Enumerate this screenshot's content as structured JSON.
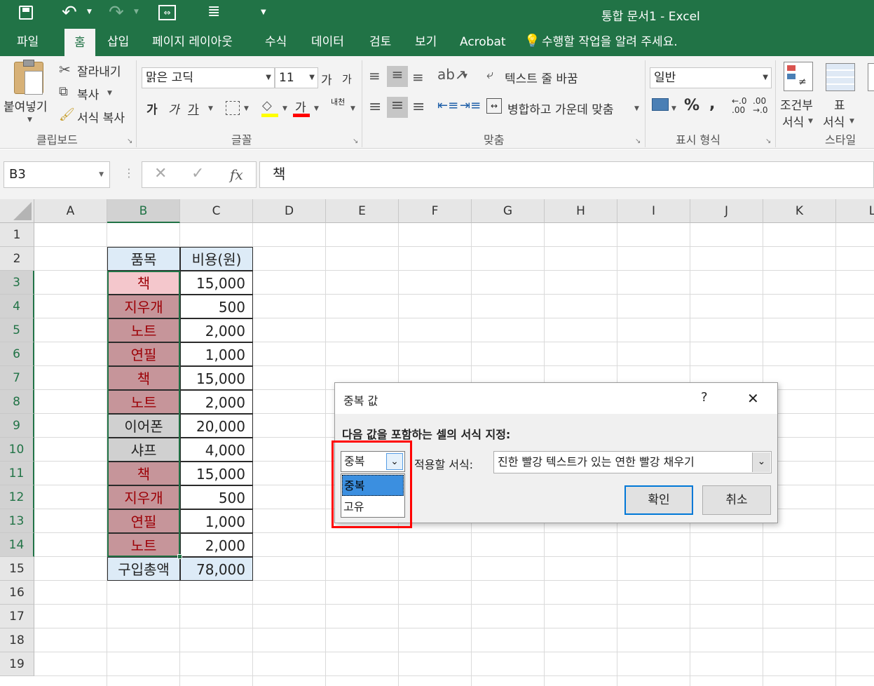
{
  "window": {
    "title": "통합 문서1 - Excel"
  },
  "tabs": [
    "파일",
    "홈",
    "삽입",
    "페이지 레이아웃",
    "수식",
    "데이터",
    "검토",
    "보기",
    "Acrobat"
  ],
  "tell_me": "수행할 작업을 알려 주세요.",
  "clipboard": {
    "paste": "붙여넣기",
    "cut": "잘라내기",
    "copy": "복사",
    "format_painter": "서식 복사",
    "group_label": "클립보드"
  },
  "font": {
    "family": "맑은 고딕",
    "size": "11",
    "grow": "가",
    "shrink": "가",
    "bold": "가",
    "italic": "가",
    "underline": "가",
    "font_color": "가",
    "phonetic": "내천",
    "group_label": "글꼴"
  },
  "alignment": {
    "wrap_text": "텍스트 줄 바꿈",
    "merge_center": "병합하고 가운데 맞춤",
    "group_label": "맞춤"
  },
  "number": {
    "format": "일반",
    "percent": "%",
    "comma": ",",
    "inc_decimal": "←.0\n.00",
    "dec_decimal": ".00\n→.0",
    "group_label": "표시 형식"
  },
  "styles": {
    "conditional_line1": "조건부",
    "conditional_line2": "서식",
    "table_line1": "표",
    "table_line2": "서식",
    "group_label": "스타일"
  },
  "formula_bar": {
    "name_box": "B3",
    "fx": "fx",
    "content": "책"
  },
  "grid": {
    "columns": [
      "A",
      "B",
      "C",
      "D",
      "E",
      "F",
      "G",
      "H",
      "I",
      "J",
      "K",
      "L"
    ],
    "rows": [
      "1",
      "2",
      "3",
      "4",
      "5",
      "6",
      "7",
      "8",
      "9",
      "10",
      "11",
      "12",
      "13",
      "14",
      "15",
      "16",
      "17",
      "18",
      "19"
    ],
    "header": [
      "품목",
      "비용(원)"
    ],
    "items": [
      {
        "name": "책",
        "cost": "15,000"
      },
      {
        "name": "지우개",
        "cost": "500"
      },
      {
        "name": "노트",
        "cost": "2,000"
      },
      {
        "name": "연필",
        "cost": "1,000"
      },
      {
        "name": "책",
        "cost": "15,000"
      },
      {
        "name": "노트",
        "cost": "2,000"
      },
      {
        "name": "이어폰",
        "cost": "20,000"
      },
      {
        "name": "샤프",
        "cost": "4,000"
      },
      {
        "name": "책",
        "cost": "15,000"
      },
      {
        "name": "지우개",
        "cost": "500"
      },
      {
        "name": "연필",
        "cost": "1,000"
      },
      {
        "name": "노트",
        "cost": "2,000"
      }
    ],
    "total_label": "구입총액",
    "total_value": "78,000"
  },
  "dialog": {
    "title": "중복 값",
    "help": "?",
    "close": "✕",
    "instruction": "다음 값을 포함하는 셀의 서식 지정:",
    "rule_value": "중복",
    "rule_options": [
      "중복",
      "고유"
    ],
    "format_label": "적용할 서식:",
    "format_value": "진한 빨강 텍스트가 있는 연한 빨강 채우기",
    "ok": "확인",
    "cancel": "취소"
  },
  "colors": {
    "excel_green": "#217346",
    "dup_fill": "#c6959a",
    "dup_text": "#9c0006",
    "header_fill": "#ddebf7",
    "highlight": "#ff0000"
  }
}
